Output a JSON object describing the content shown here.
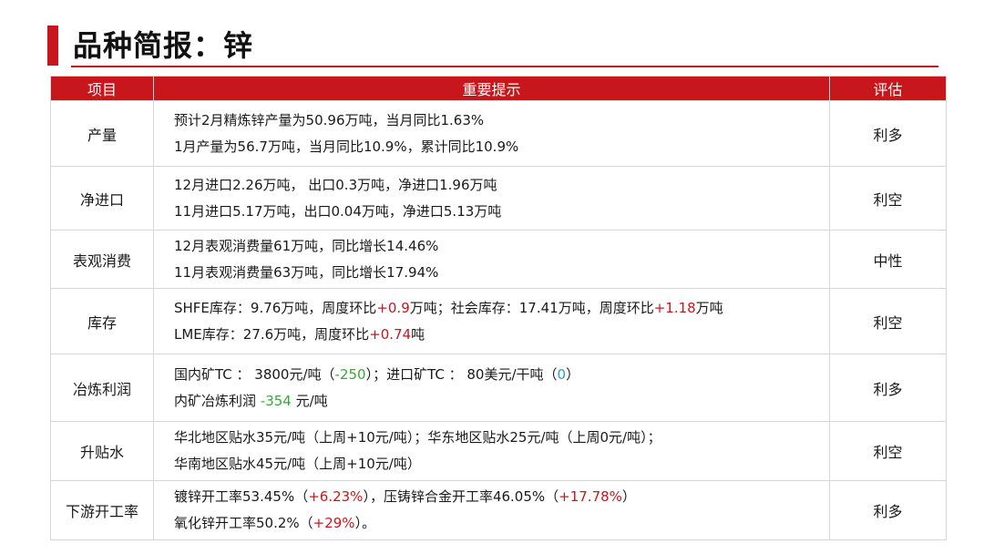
{
  "title": "品种简报：锌",
  "colors": {
    "accent": "#c8161d",
    "positive": "#c8161d",
    "negative": "#35a935",
    "neutral": "#2a9ac8"
  },
  "table": {
    "headers": [
      "项目",
      "重要提示",
      "评估"
    ],
    "rows": [
      {
        "item": "产量",
        "eval": "利多",
        "lines": [
          [
            {
              "t": "预计2月精炼锌产量为50.96万吨，当月同比1.63%"
            }
          ],
          [
            {
              "t": "1月产量为56.7万吨，当月同比10.9%，累计同比10.9%"
            }
          ]
        ]
      },
      {
        "item": "净进口",
        "eval": "利空",
        "lines": [
          [
            {
              "t": "12月进口2.26万吨， 出口0.3万吨，净进口1.96万吨"
            }
          ],
          [
            {
              "t": "11月进口5.17万吨，出口0.04万吨，净进口5.13万吨"
            }
          ]
        ]
      },
      {
        "item": "表观消费",
        "eval": "中性",
        "lines": [
          [
            {
              "t": "12月表观消费量61万吨，同比增长14.46%"
            }
          ],
          [
            {
              "t": "11月表观消费量63万吨，同比增长17.94%"
            }
          ]
        ]
      },
      {
        "item": "库存",
        "eval": "利空",
        "lines": [
          [
            {
              "t": "SHFE库存：9.76万吨，周度环比"
            },
            {
              "t": "+0.9",
              "c": "red"
            },
            {
              "t": "万吨；社会库存：17.41万吨，周度环比"
            },
            {
              "t": "+1.18",
              "c": "red"
            },
            {
              "t": "万吨"
            }
          ],
          [
            {
              "t": "LME库存：27.6万吨，周度环比"
            },
            {
              "t": "+0.74",
              "c": "red"
            },
            {
              "t": "吨"
            }
          ]
        ]
      },
      {
        "item": "冶炼利润",
        "eval": "利多",
        "lines": [
          [
            {
              "t": "国内矿TC ： 3800元/吨（"
            },
            {
              "t": "-250",
              "c": "green"
            },
            {
              "t": "）；进口矿TC ： 80美元/干吨（"
            },
            {
              "t": "0",
              "c": "blue"
            },
            {
              "t": "）"
            }
          ],
          [
            {
              "t": "内矿冶炼利润 "
            },
            {
              "t": "-354",
              "c": "green"
            },
            {
              "t": " 元/吨"
            }
          ]
        ]
      },
      {
        "item": "升贴水",
        "eval": "利空",
        "lines": [
          [
            {
              "t": "华北地区贴水35元/吨（上周+10元/吨）；华东地区贴水25元/吨（上周0元/吨）；"
            }
          ],
          [
            {
              "t": "华南地区贴水45元/吨（上周+10元/吨）"
            }
          ]
        ]
      },
      {
        "item": "下游开工率",
        "eval": "利多",
        "lines": [
          [
            {
              "t": "镀锌开工率53.45%（"
            },
            {
              "t": "+6.23%",
              "c": "red"
            },
            {
              "t": "），压铸锌合金开工率46.05%（"
            },
            {
              "t": "+17.78%",
              "c": "red"
            },
            {
              "t": "）"
            }
          ],
          [
            {
              "t": "氧化锌开工率50.2%（"
            },
            {
              "t": "+29%",
              "c": "red"
            },
            {
              "t": "）。"
            }
          ]
        ]
      }
    ]
  }
}
